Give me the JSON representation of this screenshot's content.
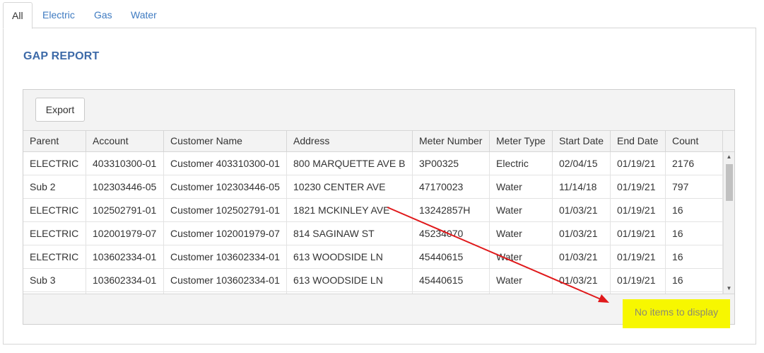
{
  "tabs": [
    {
      "label": "All",
      "active": true
    },
    {
      "label": "Electric"
    },
    {
      "label": "Gas"
    },
    {
      "label": "Water"
    }
  ],
  "report": {
    "title": "GAP REPORT"
  },
  "toolbar": {
    "export_label": "Export"
  },
  "columns": [
    "Parent",
    "Account",
    "Customer Name",
    "Address",
    "Meter Number",
    "Meter Type",
    "Start Date",
    "End Date",
    "Count"
  ],
  "rows": [
    [
      "ELECTRIC",
      "403310300-01",
      "Customer 403310300-01",
      "800 MARQUETTE AVE B",
      "3P00325",
      "Electric",
      "02/04/15",
      "01/19/21",
      "2176"
    ],
    [
      "Sub 2",
      "102303446-05",
      "Customer 102303446-05",
      "10230 CENTER AVE",
      "47170023",
      "Water",
      "11/14/18",
      "01/19/21",
      "797"
    ],
    [
      "ELECTRIC",
      "102502791-01",
      "Customer 102502791-01",
      "1821 MCKINLEY AVE",
      "13242857H",
      "Water",
      "01/03/21",
      "01/19/21",
      "16"
    ],
    [
      "ELECTRIC",
      "102001979-07",
      "Customer 102001979-07",
      "814 SAGINAW ST",
      "45234070",
      "Water",
      "01/03/21",
      "01/19/21",
      "16"
    ],
    [
      "ELECTRIC",
      "103602334-01",
      "Customer 103602334-01",
      "613 WOODSIDE LN",
      "45440615",
      "Water",
      "01/03/21",
      "01/19/21",
      "16"
    ],
    [
      "Sub 3",
      "103602334-01",
      "Customer 103602334-01",
      "613 WOODSIDE LN",
      "45440615",
      "Water",
      "01/03/21",
      "01/19/21",
      "16"
    ],
    [
      "",
      "",
      "",
      "",
      "",
      "",
      "",
      "",
      ""
    ]
  ],
  "footer": {
    "status": "No items to display"
  },
  "colors": {
    "accent": "#3d6aa8",
    "link": "#3f7bc1",
    "highlight": "#f7f700",
    "arrow": "#e0191b"
  }
}
